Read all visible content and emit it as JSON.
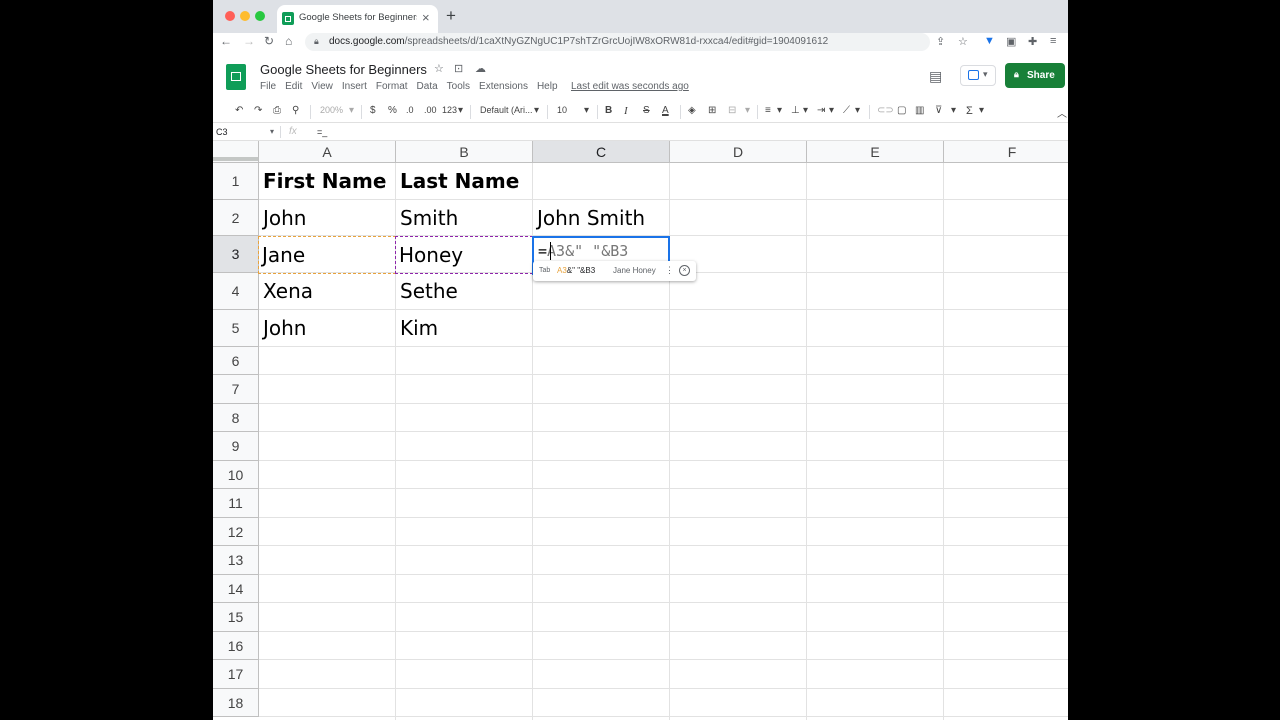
{
  "browser": {
    "tab_title": "Google Sheets for Beginners -",
    "tab_close": "×",
    "new_tab": "+",
    "url_host": "docs.google.com",
    "url_path": "/spreadsheets/d/1caXtNyGZNgUC1P7shTZrGrcUojIW8xORW81d-rxxca4/edit#gid=1904091612",
    "icons": [
      "back-icon",
      "forward-icon",
      "reload-icon",
      "home-icon",
      "lock-icon",
      "share-page-icon",
      "bookmark-star-icon",
      "extension-icon",
      "puzzle-icon",
      "reading-list-icon"
    ]
  },
  "sheets": {
    "doc_title": "Google Sheets for Beginners",
    "menus": [
      "File",
      "Edit",
      "View",
      "Insert",
      "Format",
      "Data",
      "Tools",
      "Extensions",
      "Help"
    ],
    "last_edit": "Last edit was seconds ago",
    "share_label": "Share"
  },
  "toolbar": {
    "zoom": "200%",
    "currency": "$",
    "percent": "%",
    "dec_less": ".0",
    "dec_more": ".00",
    "number_format": "123",
    "font": "Default (Ari...",
    "font_size": "10",
    "bold": "B",
    "italic": "I",
    "strike": "S",
    "text_color": "A",
    "function": "Σ"
  },
  "formula_bar": {
    "name_box": "C3",
    "fx_label": "fx",
    "value": "=_"
  },
  "grid": {
    "columns": [
      "A",
      "B",
      "C",
      "D",
      "E",
      "F"
    ],
    "rows": [
      "1",
      "2",
      "3",
      "4",
      "5",
      "6",
      "7",
      "8",
      "9",
      "10",
      "11",
      "12",
      "13",
      "14",
      "15",
      "16",
      "17",
      "18"
    ],
    "selected_column": "C",
    "selected_row": "3",
    "cells": {
      "A1": "First Name",
      "B1": "Last Name",
      "A2": "John",
      "B2": "Smith",
      "C2": "John Smith",
      "A3": "Jane",
      "B3": "Honey",
      "A4": "Xena",
      "B4": "Sethe",
      "A5": "John",
      "B5": "Kim"
    },
    "editing": {
      "cell": "C3",
      "typed": "=",
      "hint": "A3&\" \"&B3"
    },
    "suggestion": {
      "key": "Tab",
      "ref_a": "A3",
      "rest": "&\" \"&B3",
      "result": "Jane Honey"
    }
  }
}
